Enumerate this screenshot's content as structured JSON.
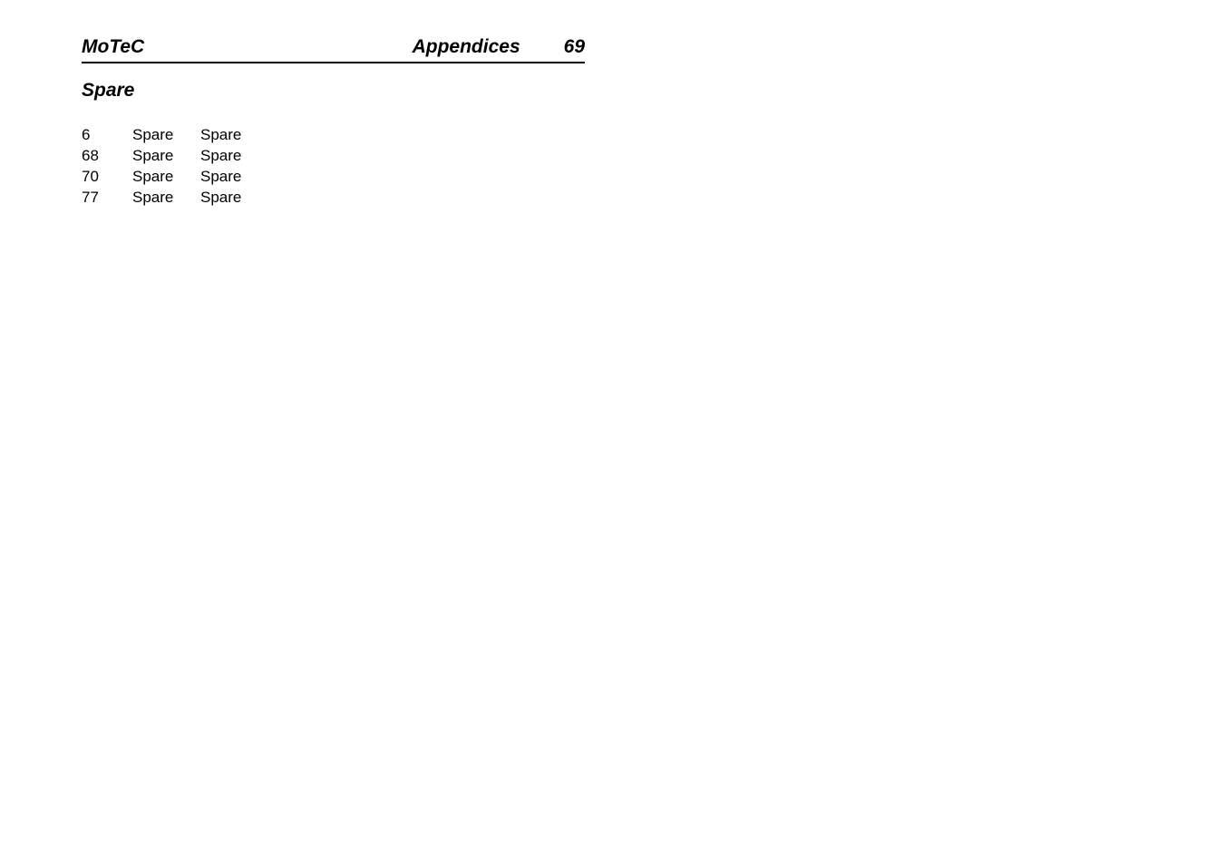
{
  "header": {
    "brand": "MoTeC",
    "section": "Appendices",
    "page_number": "69"
  },
  "subtitle": "Spare",
  "table": {
    "rows": [
      {
        "pin": "6",
        "name": "Spare",
        "desc": "Spare"
      },
      {
        "pin": "68",
        "name": "Spare",
        "desc": "Spare"
      },
      {
        "pin": "70",
        "name": "Spare",
        "desc": "Spare"
      },
      {
        "pin": "77",
        "name": "Spare",
        "desc": "Spare"
      }
    ]
  }
}
